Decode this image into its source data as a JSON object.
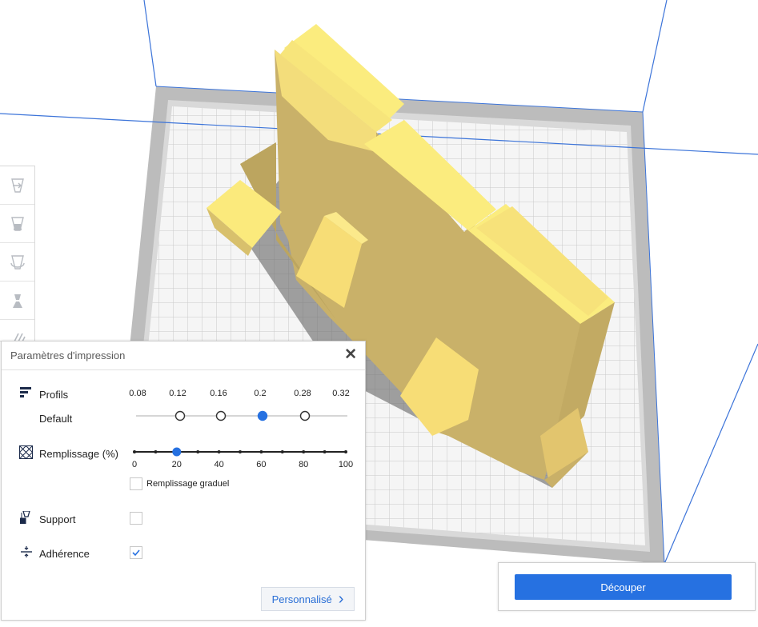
{
  "panel": {
    "title": "Paramètres d'impression",
    "close_glyph": "✕",
    "profiles": {
      "label": "Profils",
      "selected_name": "Default",
      "layer_values": [
        "0.08",
        "0.12",
        "0.16",
        "0.2",
        "0.28",
        "0.32"
      ],
      "selected_value": "0.2"
    },
    "infill": {
      "label": "Remplissage (%)",
      "ticks": [
        "0",
        "20",
        "40",
        "60",
        "80",
        "100"
      ],
      "value": 20,
      "gradual_label": "Remplissage graduel",
      "gradual_checked": false
    },
    "support": {
      "label": "Support",
      "checked": false
    },
    "adhesion": {
      "label": "Adhérence",
      "checked": true
    },
    "custom_button": "Personnalisé",
    "custom_chevron": "›"
  },
  "slice": {
    "button_label": "Découper"
  },
  "colors": {
    "accent": "#2671e1",
    "model": "#dcc874",
    "build_plate": "#f4f4f4"
  },
  "icons": [
    "move-icon",
    "scale-icon",
    "rotate-icon",
    "mirror-icon",
    "per-model-settings-icon",
    "profiles-icon",
    "infill-icon",
    "support-icon",
    "adhesion-icon",
    "close-icon",
    "chevron-right-icon"
  ]
}
